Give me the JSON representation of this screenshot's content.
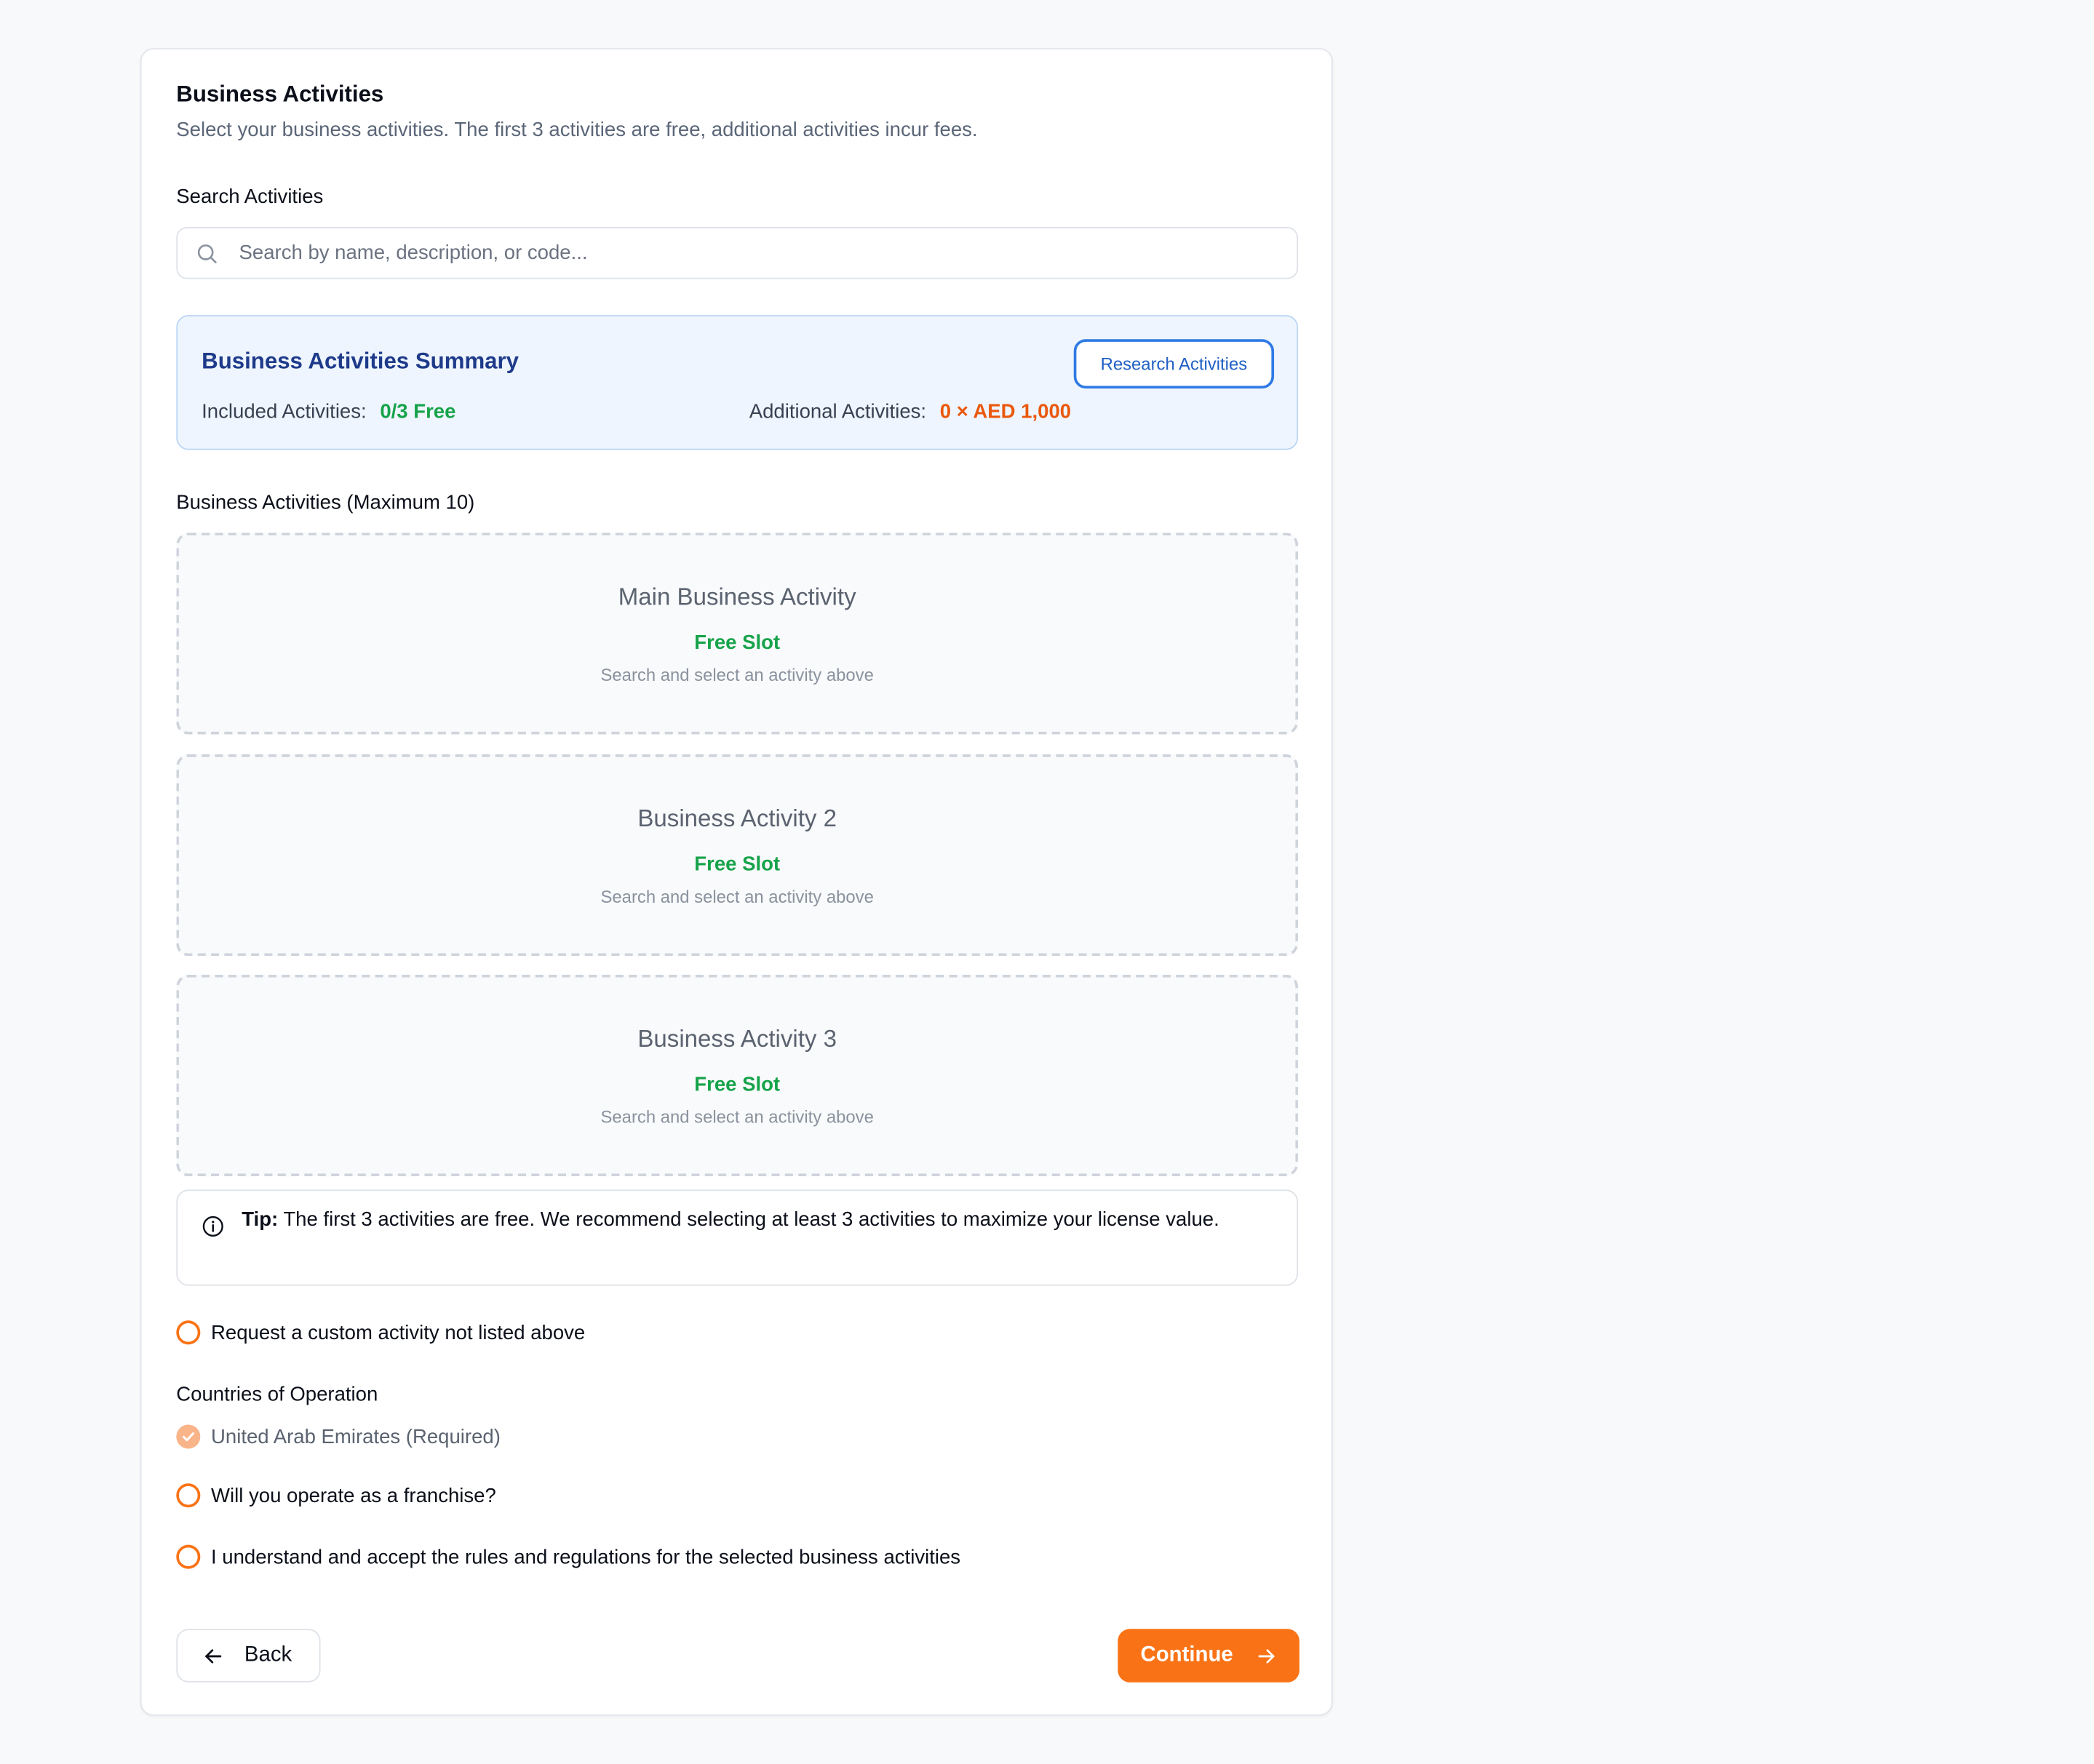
{
  "header": {
    "title": "Business Activities",
    "subtitle": "Select your business activities. The first 3 activities are free, additional activities incur fees."
  },
  "search": {
    "label": "Search Activities",
    "placeholder": "Search by name, description, or code...",
    "value": ""
  },
  "summary": {
    "title": "Business Activities Summary",
    "research_button": "Research Activities",
    "included_label": "Included Activities:",
    "included_value": "0/3 Free",
    "additional_label": "Additional Activities:",
    "additional_value": "0 × AED 1,000"
  },
  "activities": {
    "label": "Business Activities (Maximum 10)",
    "slots": [
      {
        "name": "Main Business Activity",
        "status": "Free Slot",
        "hint": "Search and select an activity above"
      },
      {
        "name": "Business Activity 2",
        "status": "Free Slot",
        "hint": "Search and select an activity above"
      },
      {
        "name": "Business Activity 3",
        "status": "Free Slot",
        "hint": "Search and select an activity above"
      }
    ]
  },
  "tip": {
    "prefix": "Tip:",
    "text": " The first 3 activities are free. We recommend selecting at least 3 activities to maximize your license value."
  },
  "custom_activity": {
    "label": "Request a custom activity not listed above",
    "checked": false
  },
  "countries": {
    "label": "Countries of Operation",
    "items": [
      {
        "label": "United Arab Emirates (Required)",
        "checked": true,
        "disabled": true
      }
    ]
  },
  "franchise": {
    "label": "Will you operate as a franchise?",
    "checked": false
  },
  "accept_rules": {
    "label": "I understand and accept the rules and regulations for the selected business activities",
    "checked": false
  },
  "footer": {
    "back_label": "Back",
    "continue_label": "Continue"
  },
  "colors": {
    "accent": "#f97316",
    "success": "#16a34a",
    "link": "#2f7ae5",
    "summary_bg": "#eef5fe"
  },
  "icons": {
    "search": "search-icon",
    "info": "info-icon",
    "back": "arrow-left-icon",
    "continue": "arrow-right-icon",
    "check": "check-icon"
  }
}
